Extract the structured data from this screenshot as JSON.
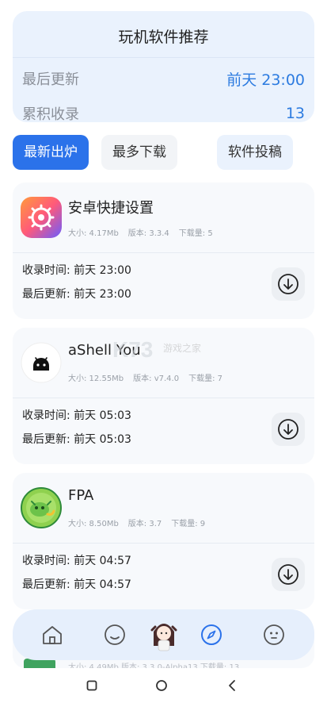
{
  "summary": {
    "title": "玩机软件推荐",
    "last_update_label": "最后更新",
    "last_update_value": "前天 23:00",
    "total_label": "累积收录",
    "total_value": "13"
  },
  "tabs": [
    {
      "label": "最新出炉",
      "active": true
    },
    {
      "label": "最多下载",
      "active": false
    },
    {
      "label": "软件投稿",
      "active": false
    }
  ],
  "apps": [
    {
      "name": "安卓快捷设置",
      "size": "大小: 4.17Mb",
      "version": "版本: 3.3.4",
      "downloads": "下载量: 5",
      "collected": "收录时间: 前天 23:00",
      "updated": "最后更新: 前天 23:00",
      "icon": "gear-icon"
    },
    {
      "name": "aShell You",
      "size": "大小: 12.55Mb",
      "version": "版本: v7.4.0",
      "downloads": "下载量: 7",
      "collected": "收录时间: 前天 05:03",
      "updated": "最后更新: 前天 05:03",
      "icon": "android-icon"
    },
    {
      "name": "FPA",
      "size": "大小: 8.50Mb",
      "version": "版本: 3.7",
      "downloads": "下载量: 9",
      "collected": "收录时间: 前天 04:57",
      "updated": "最后更新: 前天 04:57",
      "icon": "dragon-icon"
    }
  ],
  "peek": {
    "meta": "大小: 4.49Mb    版本: 3.3.0-Alpha13    下载量: 13"
  },
  "watermark": {
    "text": "游戏之家"
  },
  "tabbar": {
    "items": [
      "home-icon",
      "smile-icon",
      "avatar",
      "compass-icon",
      "ghost-icon"
    ],
    "active": "compass-icon"
  },
  "colors": {
    "accent": "#2b72ea",
    "value_blue": "#2c7be0",
    "card_bg": "#f7f9fc",
    "summary_bg": "#eaf2fd"
  }
}
